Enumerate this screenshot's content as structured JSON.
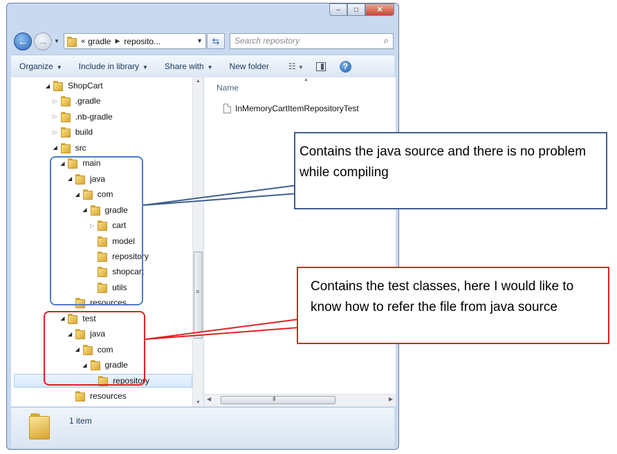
{
  "window": {
    "controls": {
      "minimize": "–",
      "maximize": "□",
      "close": "✕"
    }
  },
  "address_bar": {
    "chevron": "«",
    "path": [
      "gradle",
      "reposito..."
    ],
    "search_placeholder": "Search repository"
  },
  "toolbar": {
    "items": [
      "Organize",
      "Include in library",
      "Share with",
      "New folder"
    ]
  },
  "tree": [
    {
      "label": "ShopCart",
      "level": 0,
      "state": "open"
    },
    {
      "label": ".gradle",
      "level": 1,
      "state": "closed"
    },
    {
      "label": ".nb-gradle",
      "level": 1,
      "state": "closed"
    },
    {
      "label": "build",
      "level": 1,
      "state": "closed"
    },
    {
      "label": "src",
      "level": 1,
      "state": "open"
    },
    {
      "label": "main",
      "level": 2,
      "state": "open"
    },
    {
      "label": "java",
      "level": 3,
      "state": "open"
    },
    {
      "label": "com",
      "level": 4,
      "state": "open"
    },
    {
      "label": "gradle",
      "level": 5,
      "state": "open"
    },
    {
      "label": "cart",
      "level": 6,
      "state": "closed"
    },
    {
      "label": "model",
      "level": 6,
      "state": "none"
    },
    {
      "label": "repository",
      "level": 6,
      "state": "none"
    },
    {
      "label": "shopcart",
      "level": 6,
      "state": "none"
    },
    {
      "label": "utils",
      "level": 6,
      "state": "none"
    },
    {
      "label": "resources",
      "level": 3,
      "state": "none"
    },
    {
      "label": "test",
      "level": 2,
      "state": "open"
    },
    {
      "label": "java",
      "level": 3,
      "state": "open"
    },
    {
      "label": "com",
      "level": 4,
      "state": "open"
    },
    {
      "label": "gradle",
      "level": 5,
      "state": "open"
    },
    {
      "label": "repository",
      "level": 6,
      "state": "none",
      "selected": true
    },
    {
      "label": "resources",
      "level": 3,
      "state": "none"
    }
  ],
  "file_list": {
    "column_name": "Name",
    "files": [
      "InMemoryCartItemRepositoryTest"
    ]
  },
  "details": {
    "item_count": "1 item"
  },
  "callouts": {
    "blue": "Contains the    java source  and there is no problem while compiling",
    "red": "Contains the test classes, here I would like  to know how to refer the file from java source"
  },
  "colors": {
    "blue_callout": "#3d5e8c",
    "red_callout": "#e02020"
  }
}
